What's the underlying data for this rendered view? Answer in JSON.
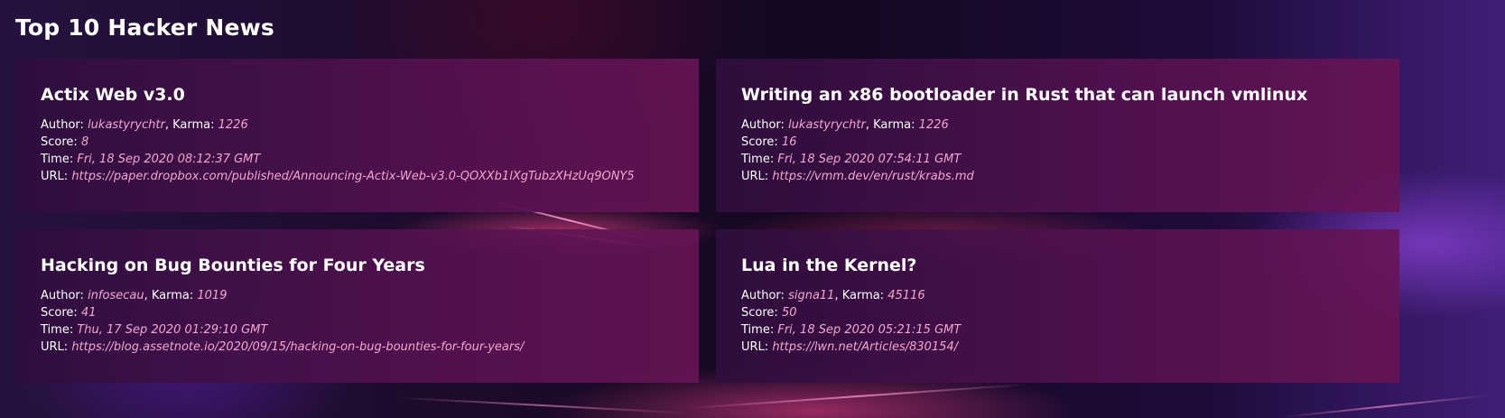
{
  "page": {
    "title": "Top 10 Hacker News"
  },
  "labels": {
    "author": "Author:",
    "karma": ", Karma:",
    "score": "Score:",
    "time": "Time:",
    "url": "URL:"
  },
  "colors": {
    "text": "#ffffff",
    "value": "#f3a6cf",
    "card_left": "#2e0e3e",
    "card_right": "#681456"
  },
  "stories": [
    {
      "title": "Actix Web v3.0",
      "author": "lukastyrychtr",
      "karma": "1226",
      "score": "8",
      "time": "Fri, 18 Sep 2020 08:12:37 GMT",
      "url": "https://paper.dropbox.com/published/Announcing-Actix-Web-v3.0-QOXXb1lXgTubzXHzUq9ONY5"
    },
    {
      "title": "Writing an x86 bootloader in Rust that can launch vmlinux",
      "author": "lukastyrychtr",
      "karma": "1226",
      "score": "16",
      "time": "Fri, 18 Sep 2020 07:54:11 GMT",
      "url": "https://vmm.dev/en/rust/krabs.md"
    },
    {
      "title": "Hacking on Bug Bounties for Four Years",
      "author": "infosecau",
      "karma": "1019",
      "score": "41",
      "time": "Thu, 17 Sep 2020 01:29:10 GMT",
      "url": "https://blog.assetnote.io/2020/09/15/hacking-on-bug-bounties-for-four-years/"
    },
    {
      "title": "Lua in the Kernel?",
      "author": "signa11",
      "karma": "45116",
      "score": "50",
      "time": "Fri, 18 Sep 2020 05:21:15 GMT",
      "url": "https://lwn.net/Articles/830154/"
    }
  ]
}
